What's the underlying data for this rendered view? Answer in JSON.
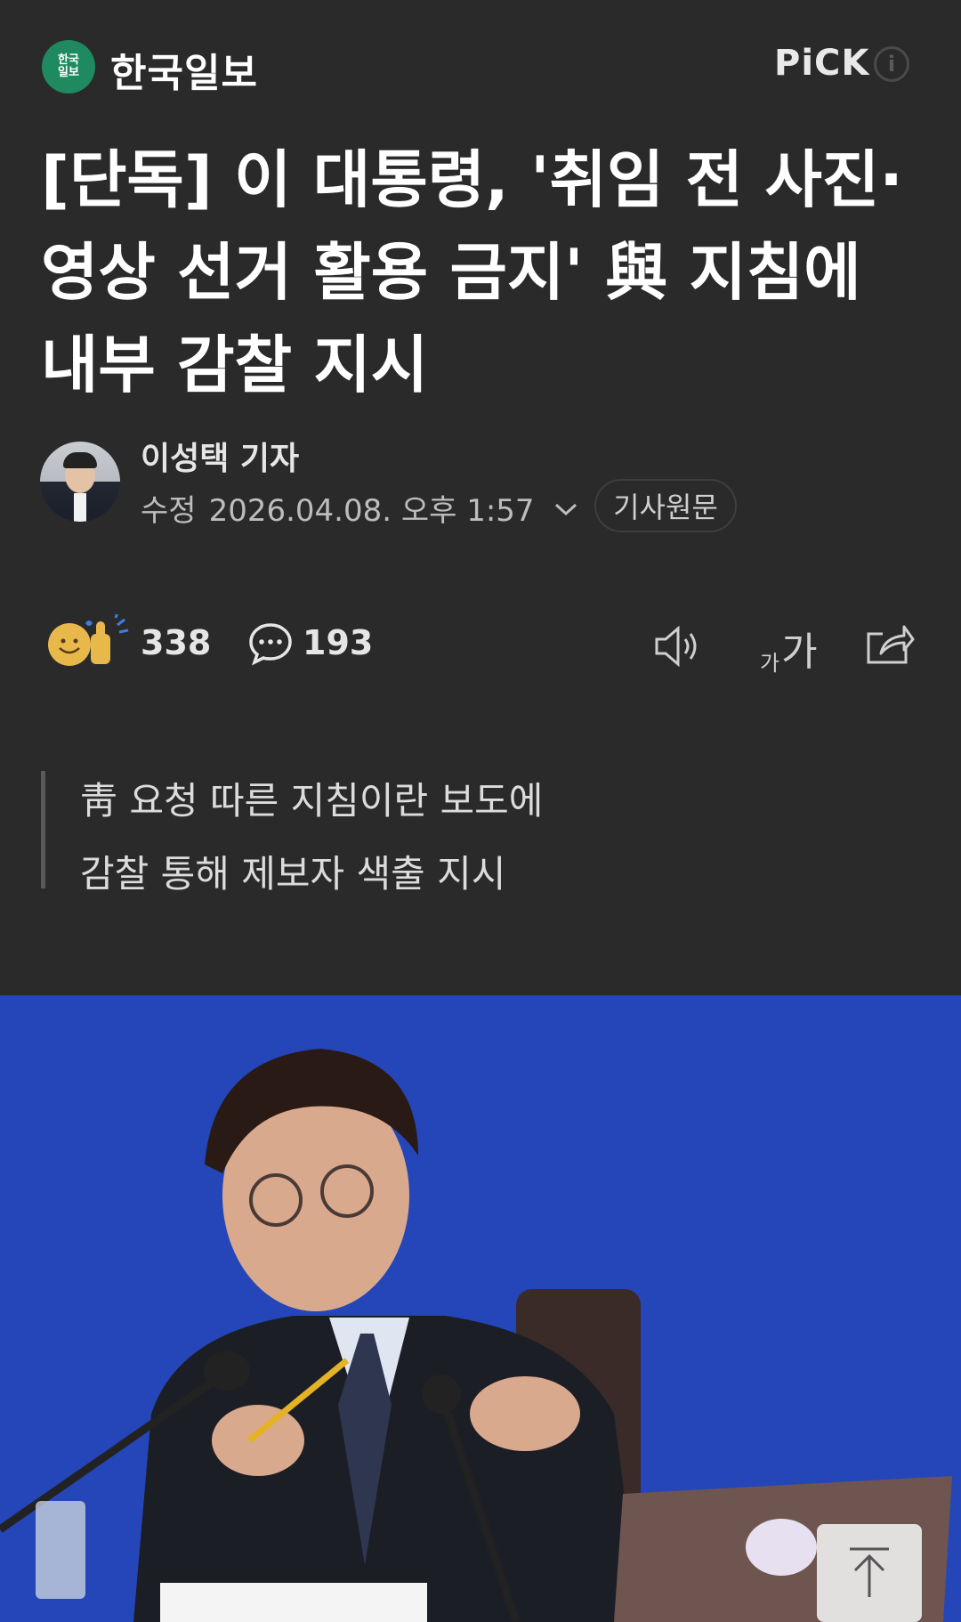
{
  "header": {
    "press_logo_text": "한국\n일보",
    "press_name": "한국일보",
    "pick_badge": "PiCK"
  },
  "article": {
    "title": "[단독] 이 대통령, '취임 전 사진·영상 선거 활용 금지' 與 지침에 내부 감찰 지시",
    "reporter": "이성택 기자",
    "date_label": "수정",
    "date_value": "2026.04.08. 오후 1:57",
    "origin_button": "기사원문"
  },
  "reactions": {
    "like_count": "338",
    "comment_count": "193",
    "font_size_small": "가",
    "font_size_big": "가"
  },
  "summary": {
    "lines": [
      "靑 요청 따른 지침이란 보도에",
      "감찰 통해 제보자 색출 지시"
    ]
  },
  "colors": {
    "background": "#2a2a2b",
    "press_green": "#1f8a5f",
    "photo_blue": "#2a4fc0"
  },
  "icons": [
    "info-icon",
    "chevron-down-icon",
    "smile-like-icon",
    "comment-icon",
    "speaker-icon",
    "share-icon",
    "arrow-up-icon"
  ]
}
